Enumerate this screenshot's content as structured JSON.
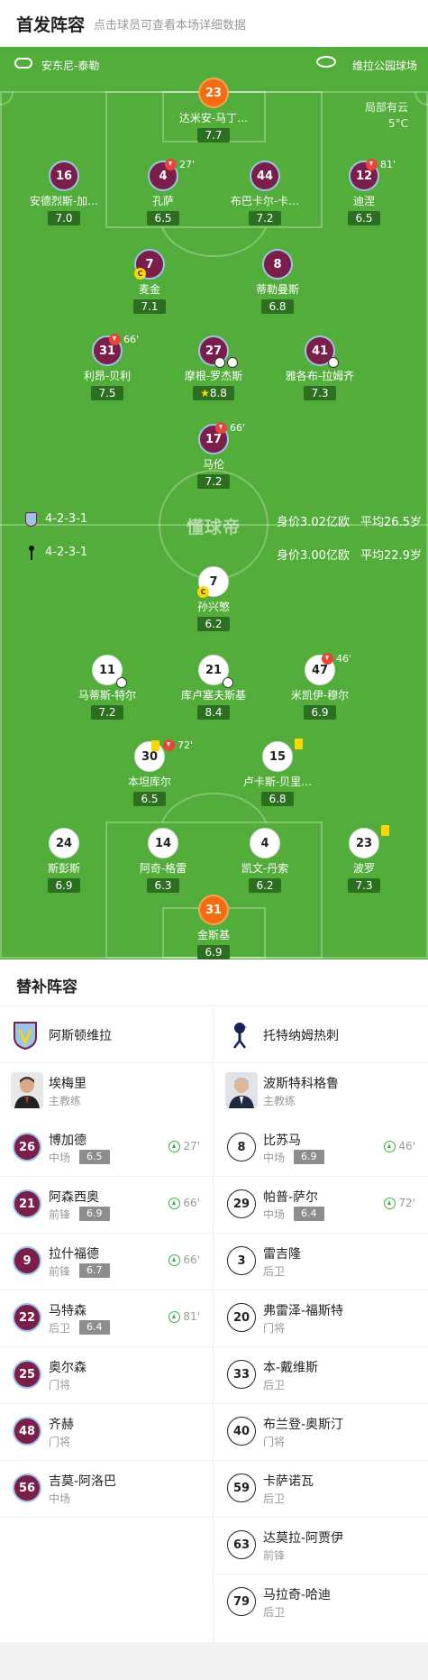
{
  "header": {
    "title": "首发阵容",
    "hint": "点击球员可查看本场详细数据"
  },
  "match_info": {
    "referee": "安东尼-泰勒",
    "stadium": "维拉公园球场",
    "weather": "局部有云",
    "temperature": "5°C",
    "watermark": "懂球帝"
  },
  "home": {
    "formation": "4-2-3-1",
    "value": "身价3.02亿欧",
    "age": "平均26.5岁",
    "players": [
      {
        "num": "23",
        "name": "达米安-马丁…",
        "rating": "7.7"
      },
      {
        "num": "16",
        "name": "安德烈斯-加…",
        "rating": "7.0"
      },
      {
        "num": "4",
        "name": "孔萨",
        "rating": "6.5",
        "sub": "27'"
      },
      {
        "num": "44",
        "name": "布巴卡尔-卡…",
        "rating": "7.2"
      },
      {
        "num": "12",
        "name": "迪涅",
        "rating": "6.5",
        "sub": "81'"
      },
      {
        "num": "7",
        "name": "麦金",
        "rating": "7.1"
      },
      {
        "num": "8",
        "name": "蒂勒曼斯",
        "rating": "6.8"
      },
      {
        "num": "31",
        "name": "利昂-贝利",
        "rating": "7.5",
        "sub": "66'"
      },
      {
        "num": "27",
        "name": "摩根-罗杰斯",
        "rating": "8.8"
      },
      {
        "num": "41",
        "name": "雅各布-拉姆齐",
        "rating": "7.3"
      },
      {
        "num": "17",
        "name": "马伦",
        "rating": "7.2",
        "sub": "66'"
      }
    ]
  },
  "away": {
    "formation": "4-2-3-1",
    "value": "身价3.00亿欧",
    "age": "平均22.9岁",
    "players": [
      {
        "num": "7",
        "name": "孙兴慜",
        "rating": "6.2"
      },
      {
        "num": "11",
        "name": "马蒂斯-特尔",
        "rating": "7.2"
      },
      {
        "num": "21",
        "name": "库卢塞夫斯基",
        "rating": "8.4"
      },
      {
        "num": "47",
        "name": "米凯伊-穆尔",
        "rating": "6.9",
        "sub": "46'"
      },
      {
        "num": "30",
        "name": "本坦库尔",
        "rating": "6.5",
        "sub": "72'"
      },
      {
        "num": "15",
        "name": "卢卡斯-贝里…",
        "rating": "6.8"
      },
      {
        "num": "24",
        "name": "斯彭斯",
        "rating": "6.9"
      },
      {
        "num": "14",
        "name": "阿奇-格雷",
        "rating": "6.3"
      },
      {
        "num": "4",
        "name": "凯文-丹索",
        "rating": "6.2"
      },
      {
        "num": "23",
        "name": "波罗",
        "rating": "7.3"
      },
      {
        "num": "31",
        "name": "金斯基",
        "rating": "6.9"
      }
    ]
  },
  "subs": {
    "title": "替补阵容",
    "home_team": "阿斯顿维拉",
    "away_team": "托特纳姆热刺",
    "home_coach": {
      "name": "埃梅里",
      "role": "主教练"
    },
    "away_coach": {
      "name": "波斯特科格鲁",
      "role": "主教练"
    },
    "home_list": [
      {
        "num": "26",
        "name": "博加德",
        "pos": "中场",
        "rating": "6.5",
        "time": "27'"
      },
      {
        "num": "21",
        "name": "阿森西奥",
        "pos": "前锋",
        "rating": "6.9",
        "time": "66'"
      },
      {
        "num": "9",
        "name": "拉什福德",
        "pos": "前锋",
        "rating": "6.7",
        "time": "66'"
      },
      {
        "num": "22",
        "name": "马特森",
        "pos": "后卫",
        "rating": "6.4",
        "time": "81'"
      },
      {
        "num": "25",
        "name": "奥尔森",
        "pos": "门将"
      },
      {
        "num": "48",
        "name": "齐赫",
        "pos": "门将"
      },
      {
        "num": "56",
        "name": "吉莫-阿洛巴",
        "pos": "中场"
      }
    ],
    "away_list": [
      {
        "num": "8",
        "name": "比苏马",
        "pos": "中场",
        "rating": "6.9",
        "time": "46'"
      },
      {
        "num": "29",
        "name": "帕普-萨尔",
        "pos": "中场",
        "rating": "6.4",
        "time": "72'"
      },
      {
        "num": "3",
        "name": "雷吉隆",
        "pos": "后卫"
      },
      {
        "num": "20",
        "name": "弗雷泽-福斯特",
        "pos": "门将"
      },
      {
        "num": "33",
        "name": "本-戴维斯",
        "pos": "后卫"
      },
      {
        "num": "40",
        "name": "布兰登-奥斯汀",
        "pos": "门将"
      },
      {
        "num": "59",
        "name": "卡萨诺瓦",
        "pos": "后卫"
      },
      {
        "num": "63",
        "name": "达莫拉-阿贾伊",
        "pos": "前锋"
      },
      {
        "num": "79",
        "name": "马拉奇-哈迪",
        "pos": "后卫"
      }
    ]
  },
  "colors": {
    "pitch": "#52ad3a",
    "home": "#7b1e4a",
    "gk": "#f36d10"
  }
}
